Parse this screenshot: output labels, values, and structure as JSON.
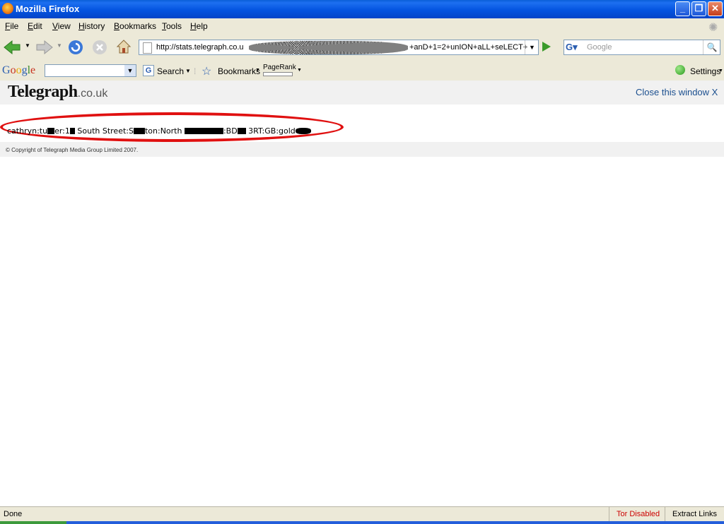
{
  "window": {
    "title": "Mozilla Firefox"
  },
  "menu": [
    "File",
    "Edit",
    "View",
    "History",
    "Bookmarks",
    "Tools",
    "Help"
  ],
  "navigation": {
    "url_prefix": "http://stats.telegraph.co.u",
    "url_suffix": "+anD+1=2+unION+aLL+seLECT+",
    "search_placeholder": "Google"
  },
  "google_toolbar": {
    "logo": "Google",
    "search_label": "Search",
    "bookmarks_label": "Bookmarks",
    "pagerank_label": "PageRank",
    "settings_label": "Settings"
  },
  "page": {
    "logo": "Telegraph",
    "logo_suffix": ".co.uk",
    "close_link": "Close this window X",
    "result_parts": [
      "cathryn:tu",
      "er:1",
      " South Street:S",
      "ton:North ",
      ":BD",
      " 3RT:GB:gold"
    ],
    "copyright": "© Copyright of Telegraph Media Group Limited 2007."
  },
  "statusbar": {
    "status": "Done",
    "tor": "Tor Disabled",
    "extract": "Extract Links",
    "tor_color": "#cc0000"
  }
}
